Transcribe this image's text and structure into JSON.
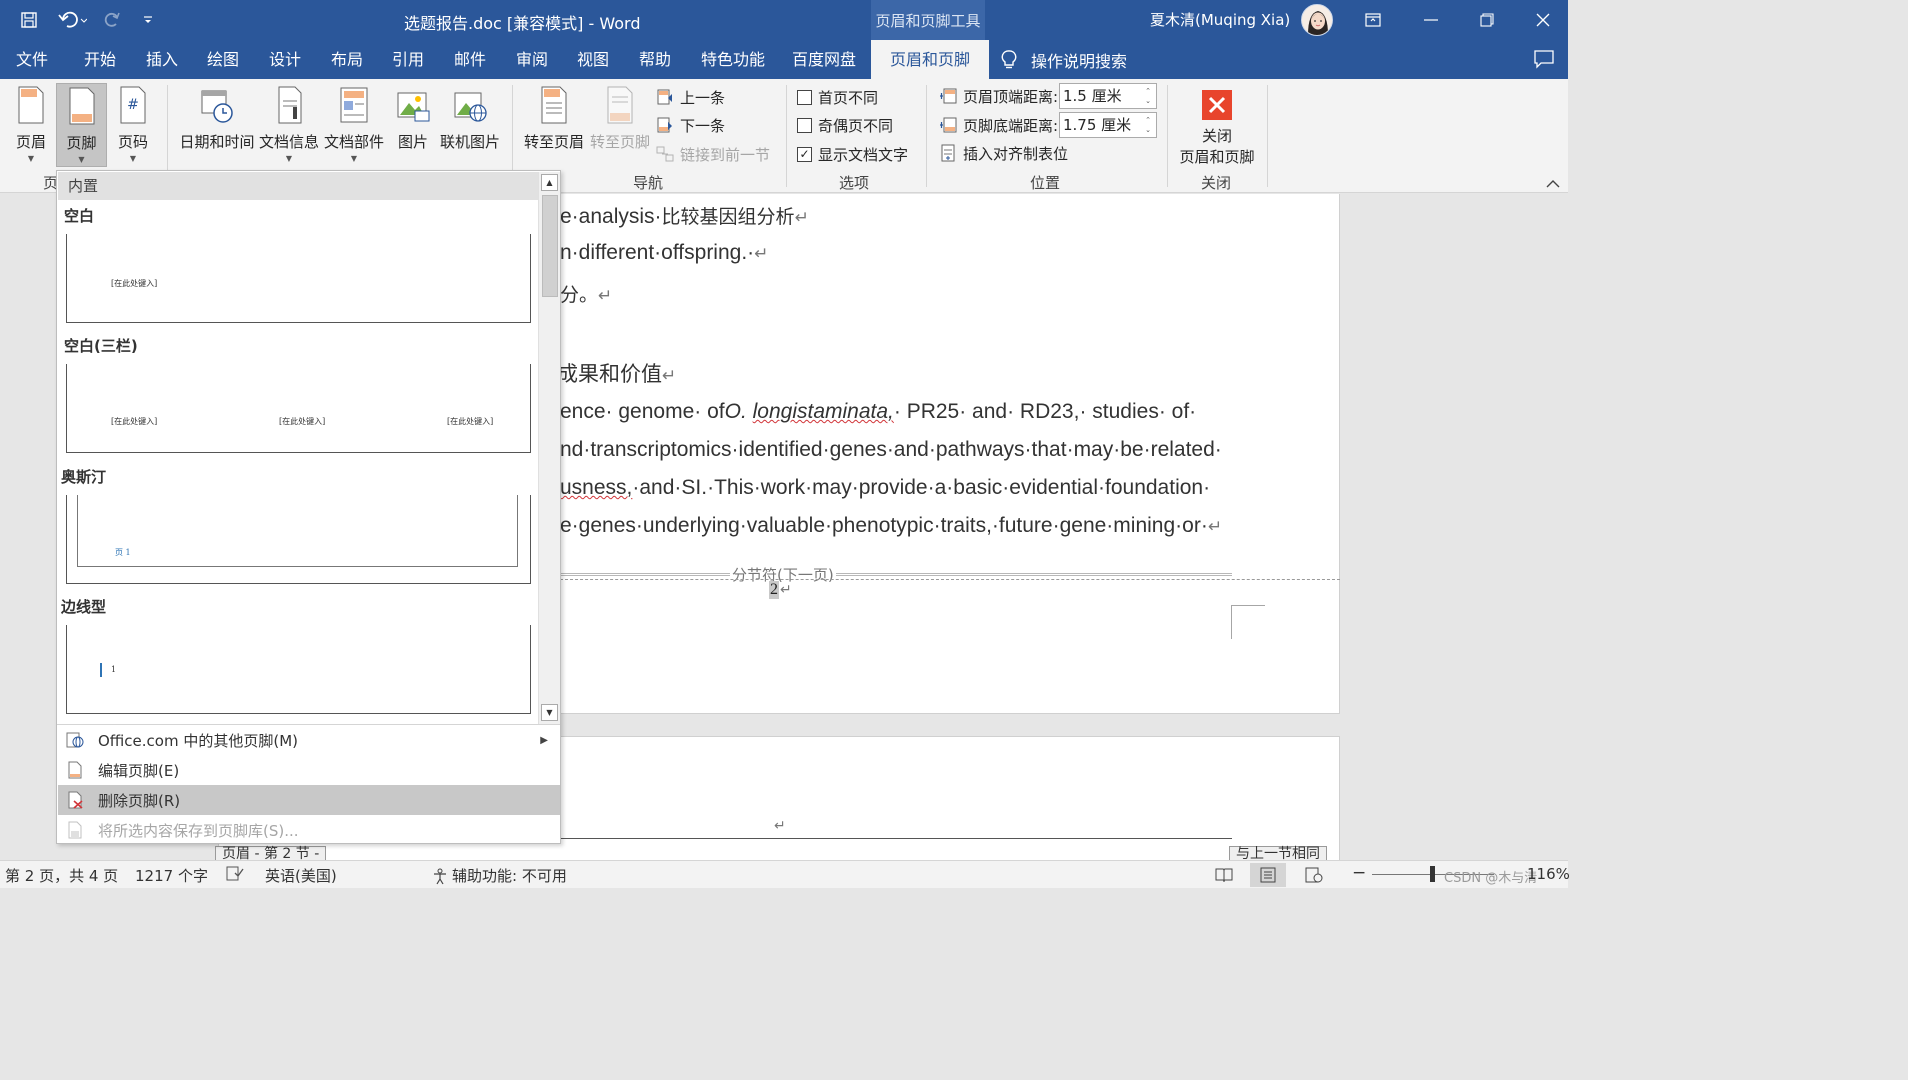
{
  "titlebar": {
    "doc_title": "选题报告.doc [兼容模式] - Word",
    "tools_tab_title": "页眉和页脚工具",
    "user_name": "夏木清(Muqing Xia)",
    "accent": "#2b579a"
  },
  "tabs": [
    "文件",
    "开始",
    "插入",
    "绘图",
    "设计",
    "布局",
    "引用",
    "邮件",
    "审阅",
    "视图",
    "帮助",
    "特色功能",
    "百度网盘",
    "页眉和页脚"
  ],
  "active_tab": "页眉和页脚",
  "tellme": "操作说明搜索",
  "ribbon": {
    "header_btn": "页眉",
    "footer_btn": "页脚",
    "pagenum_btn": "页码",
    "group_hf_cut": "页",
    "datetime_btn": "日期和时间",
    "docinfo_btn": "文档信息",
    "quickparts_btn": "文档部件",
    "picture_btn": "图片",
    "onlinepic_btn": "联机图片",
    "goto_header_btn": "转至页眉",
    "goto_footer_btn": "转至页脚",
    "prev_btn": "上一条",
    "next_btn": "下一条",
    "link_prev_btn": "链接到前一节",
    "group_nav": "导航",
    "opt_first_page": "首页不同",
    "opt_odd_even": "奇偶页不同",
    "opt_show_text": "显示文档文字",
    "group_options": "选项",
    "header_top_label": "页眉顶端距离:",
    "header_top_value": "1.5 厘米",
    "footer_bottom_label": "页脚底端距离:",
    "footer_bottom_value": "1.75 厘米",
    "insert_align_tab": "插入对齐制表位",
    "group_position": "位置",
    "close_line1": "关闭",
    "close_line2": "页眉和页脚",
    "group_close": "关闭"
  },
  "gallery": {
    "header": "内置",
    "items": [
      {
        "title": "空白",
        "placeholder": "[在此处键入]"
      },
      {
        "title": "空白(三栏)",
        "placeholder": "[在此处键入]"
      },
      {
        "title": "奥斯汀",
        "placeholder": "页 1"
      },
      {
        "title": "边线型",
        "placeholder": "1"
      }
    ],
    "menu": [
      {
        "label": "Office.com 中的其他页脚(M)",
        "icon": "office-globe-icon"
      },
      {
        "label": "编辑页脚(E)",
        "icon": "edit-footer-icon"
      },
      {
        "label": "删除页脚(R)",
        "icon": "remove-footer-icon"
      },
      {
        "label": "将所选内容保存到页脚库(S)...",
        "icon": "save-to-gallery-icon"
      }
    ]
  },
  "document": {
    "line1": "e·analysis·",
    "line1_cn": "比较基因组分析",
    "line2": "n·different·offspring.·",
    "line3_cn": "分。",
    "heading_cn": "成果和价值",
    "line5_a": "ence· genome· of",
    "line5_b": "O.",
    "line5_c": "longistaminata,",
    "line5_d": "· PR25· and· RD23,· studies· of·",
    "line6": "nd·transcriptomics·identified·genes·and·pathways·that·may·be·related·",
    "line7_a": "usness,",
    "line7_b": "·and·SI.·This·work·may·provide·a·basic·evidential·foundation·",
    "line8": "e·genes·underlying·valuable·phenotypic·traits,·future·gene·mining·or·",
    "para_mark": "↵",
    "section_break": "分节符(下一页)",
    "page_number": "2",
    "header_tag": "页眉 - 第 2 节 -",
    "same_as_prev_tag": "与上一节相同"
  },
  "status": {
    "page": "第 2 页，共 4 页",
    "words": "1217 个字",
    "language": "英语(美国)",
    "accessibility": "辅助功能: 不可用",
    "zoom": "116%",
    "watermark": "CSDN @木与清"
  }
}
